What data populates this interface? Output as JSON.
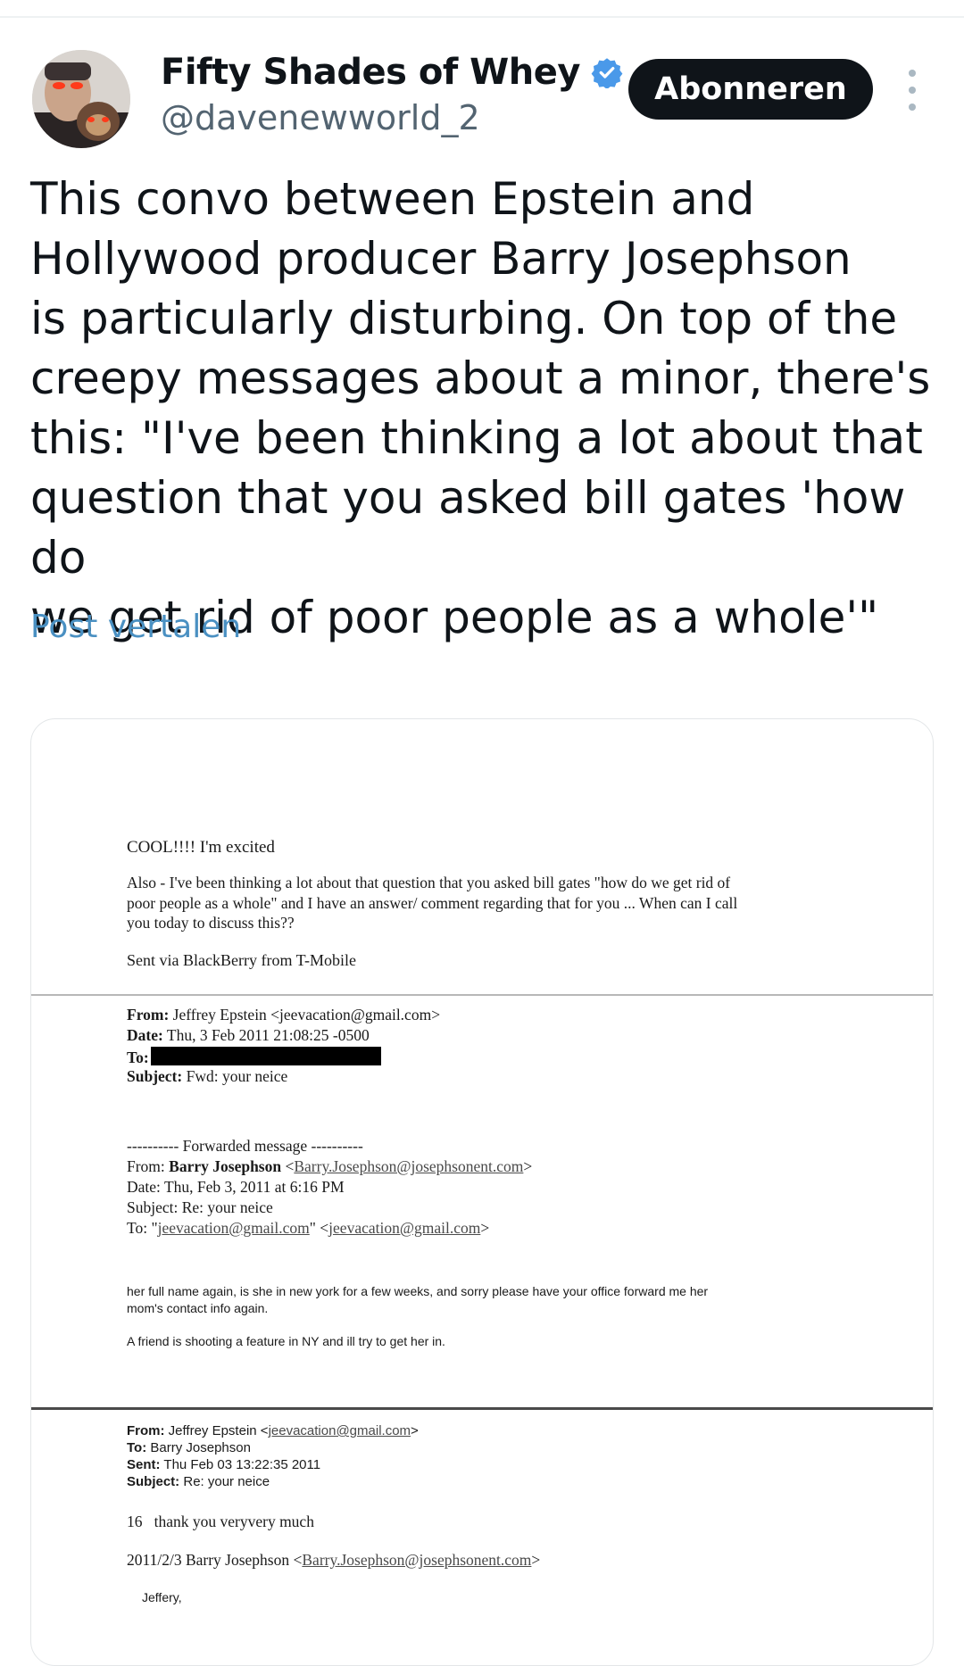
{
  "tweet": {
    "author": {
      "display_name": "Fifty Shades of Whey",
      "handle": "@davenewworld_2",
      "verified_icon": "verified-badge-icon",
      "accent": "#4a99e9"
    },
    "subscribe_label": "Abonneren",
    "more_icon": "more-vertical-icon",
    "text": "This convo between Epstein and\nHollywood producer Barry Josephson\nis particularly disturbing. On top of the\ncreepy messages about a minor, there's\nthis: \"I've been thinking a lot about that\nquestion that you asked bill gates 'how do\nwe get rid of poor people as a whole'\"",
    "translate_label": "Post vertalen"
  },
  "email_image": {
    "reply": {
      "line1": "COOL!!!! I'm excited",
      "para1_line1": "Also - I've been thinking a lot about that question that you asked bill gates \"how do we get rid of",
      "para1_line2": "poor people as a whole\" and I have an answer/ comment regarding that for you ... When can I call",
      "para1_line3": "you today to discuss this??",
      "signature": "Sent via BlackBerry from T-Mobile"
    },
    "header1": {
      "from_label": "From:",
      "from_value": "Jeffrey Epstein <jeevacation@gmail.com>",
      "date_label": "Date:",
      "date_value": "Thu, 3 Feb 2011 21:08:25 -0500",
      "to_label": "To:",
      "subject_label": "Subject:",
      "subject_value": "Fwd: your neice"
    },
    "forwarded": {
      "divider": "---------- Forwarded message ----------",
      "from_label": "From:",
      "from_name": "Barry Josephson",
      "from_email": "Barry.Josephson@josephsonent.com",
      "date_line": "Date: Thu, Feb 3, 2011 at 6:16 PM",
      "subject_line": "Subject: Re: your neice",
      "to_label": "To:",
      "to_quoted": "jeevacation@gmail.com",
      "to_email": "jeevacation@gmail.com",
      "body_line1": "her full name again, is she in new york for a few weeks, and sorry please have your office forward me her",
      "body_line2": "mom's contact info again.",
      "body_line3": "A friend is shooting a feature in NY and ill try to get her in."
    },
    "header2": {
      "from_label": "From:",
      "from_name": "Jeffrey Epstein",
      "from_email": "jeevacation@gmail.com",
      "to_label": "To:",
      "to_value": "Barry Josephson",
      "sent_label": "Sent:",
      "sent_value": "Thu Feb 03 13:22:35 2011",
      "subject_label": "Subject:",
      "subject_value": "Re: your neice",
      "body": "16   thank you veryvery much",
      "quote_prefix": "2011/2/3 Barry Josephson",
      "quote_email": "Barry.Josephson@josephsonent.com",
      "greeting": "Jeffery,"
    }
  }
}
